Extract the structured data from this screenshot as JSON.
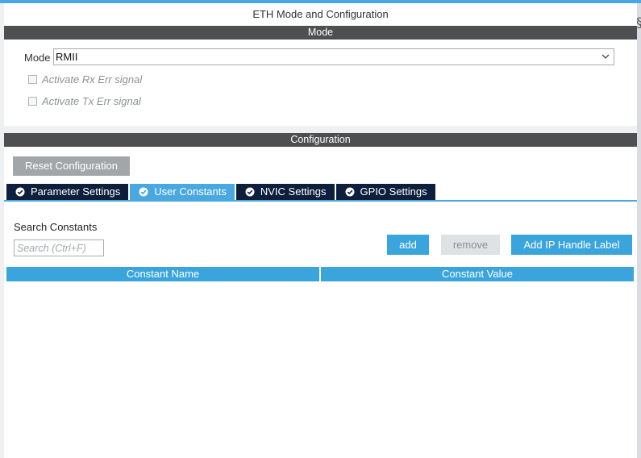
{
  "window": {
    "title": "ETH Mode and Configuration"
  },
  "mode_section": {
    "header": "Mode",
    "mode_label": "Mode",
    "mode_value": "RMII",
    "checkboxes": [
      {
        "label": "Activate Rx Err signal",
        "checked": false
      },
      {
        "label": "Activate Tx Err signal",
        "checked": false
      }
    ]
  },
  "config_section": {
    "header": "Configuration",
    "reset_label": "Reset Configuration",
    "tabs": [
      {
        "label": "Parameter Settings",
        "active": false
      },
      {
        "label": "User Constants",
        "active": true
      },
      {
        "label": "NVIC Settings",
        "active": false
      },
      {
        "label": "GPIO Settings",
        "active": false
      }
    ],
    "search_label": "Search Constants",
    "search_placeholder": "Search (Ctrl+F)",
    "buttons": {
      "add": "add",
      "remove": "remove",
      "add_handle": "Add IP Handle Label"
    },
    "table_columns": [
      "Constant Name",
      "Constant Value"
    ],
    "table_rows": []
  },
  "icons": {
    "tab_check": "check-circle-icon",
    "dropdown": "chevron-down-icon"
  },
  "colors": {
    "accent": "#3aa5dd",
    "tab_dark": "#0d1f3c",
    "section_bar": "#4d4f51",
    "disabled": "#a3a6a9"
  }
}
